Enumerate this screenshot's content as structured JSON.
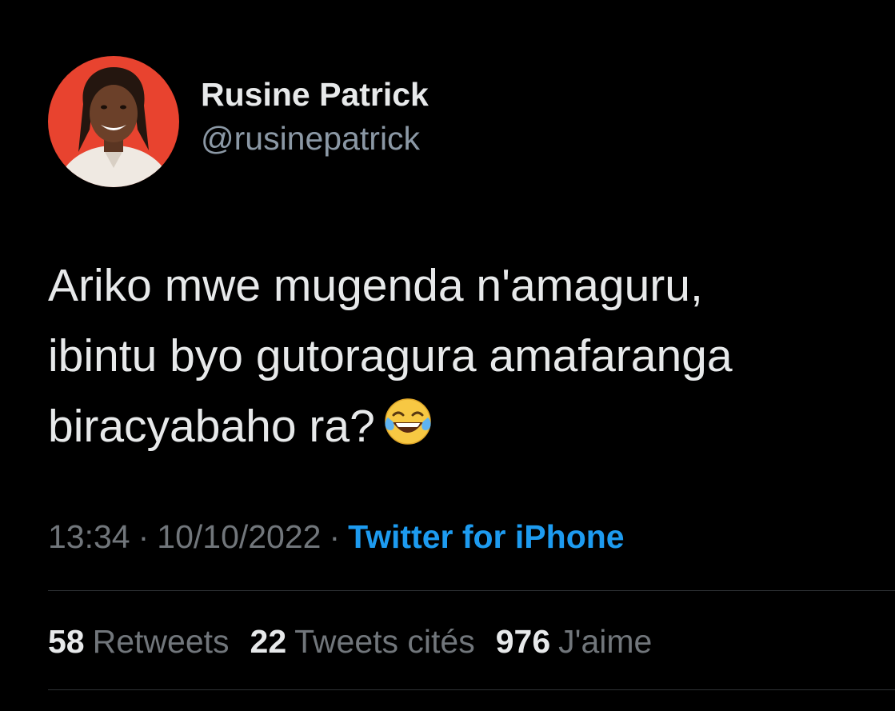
{
  "tweet": {
    "author": {
      "display_name": "Rusine Patrick",
      "handle": "@rusinepatrick",
      "avatar_icon": "profile-photo"
    },
    "text_lines": [
      "Ariko mwe mugenda n'amaguru,",
      "ibintu byo gutoragura amafaranga",
      "biracyabaho ra?"
    ],
    "emoji": "face-with-tears-of-joy",
    "time": "13:34",
    "date": "10/10/2022",
    "separator": "·",
    "source": "Twitter for iPhone",
    "stats": [
      {
        "count": "58",
        "label": "Retweets"
      },
      {
        "count": "22",
        "label": "Tweets cités"
      },
      {
        "count": "976",
        "label": "J'aime"
      }
    ]
  },
  "colors": {
    "background": "#000000",
    "primary_text": "#e7e9ea",
    "secondary_text": "#71767b",
    "link": "#1d9bf0",
    "divider": "#2f3336",
    "avatar_background": "#e8432f"
  }
}
